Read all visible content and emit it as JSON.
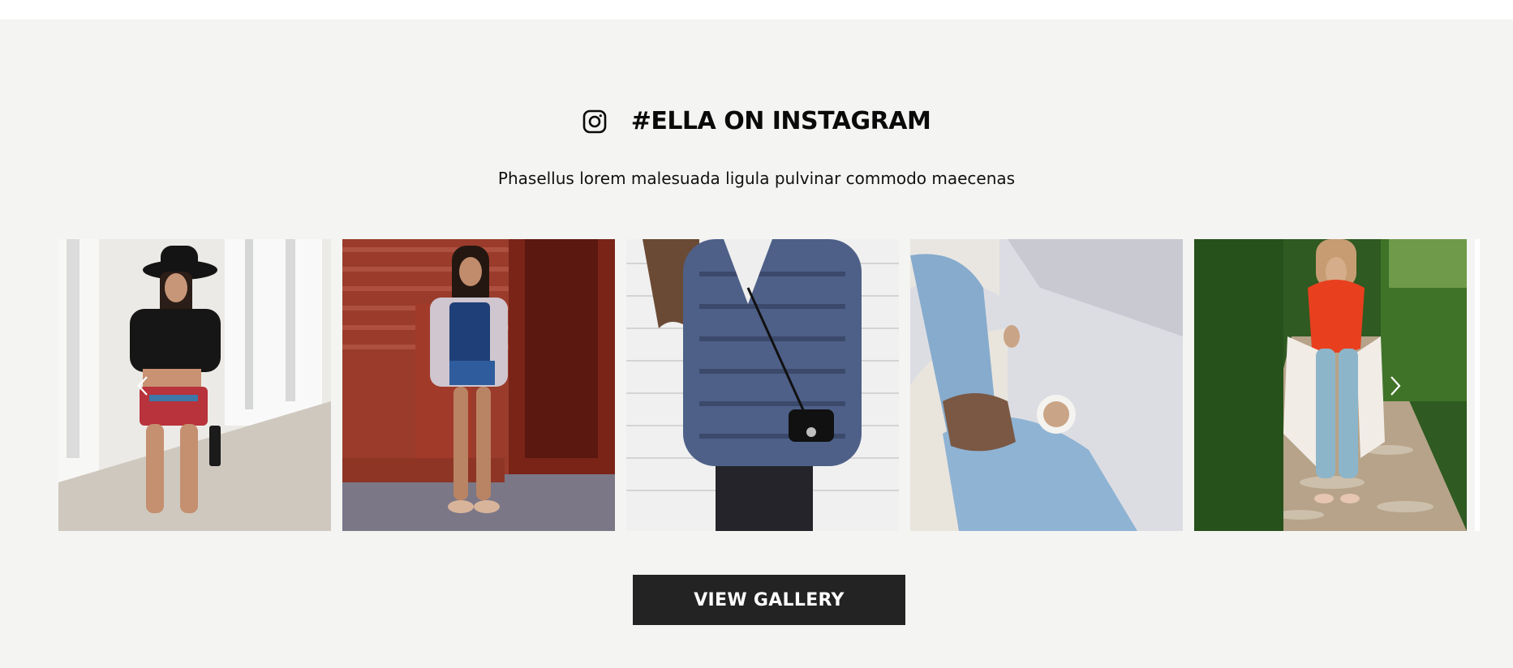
{
  "instagram": {
    "title": "#ELLA ON INSTAGRAM",
    "subtitle": "Phasellus lorem malesuada ligula pulvinar commodo maecenas",
    "icon": "instagram-icon"
  },
  "carousel": {
    "prev_icon": "chevron-left-icon",
    "next_icon": "chevron-right-icon",
    "photos": [
      {
        "name": "photo-hat-black-top",
        "palette": [
          "#f1f0ee",
          "#1a1a1a",
          "#c2453f"
        ]
      },
      {
        "name": "photo-brick-wall-overalls",
        "palette": [
          "#8a2f22",
          "#2d4f86",
          "#b4b0ba"
        ]
      },
      {
        "name": "photo-patterned-sweater",
        "palette": [
          "#eeeeee",
          "#52658c",
          "#1f1f24"
        ]
      },
      {
        "name": "photo-jeans-coffee",
        "palette": [
          "#d7d9df",
          "#8fb1cf",
          "#e8e3dc"
        ]
      },
      {
        "name": "photo-red-top-path",
        "palette": [
          "#3c6b2a",
          "#e5411f",
          "#b7a48a"
        ]
      }
    ]
  },
  "cta": {
    "label": "VIEW GALLERY"
  },
  "colors": {
    "section_bg": "#f4f4f2",
    "button_bg": "#232323",
    "button_text": "#ffffff"
  }
}
